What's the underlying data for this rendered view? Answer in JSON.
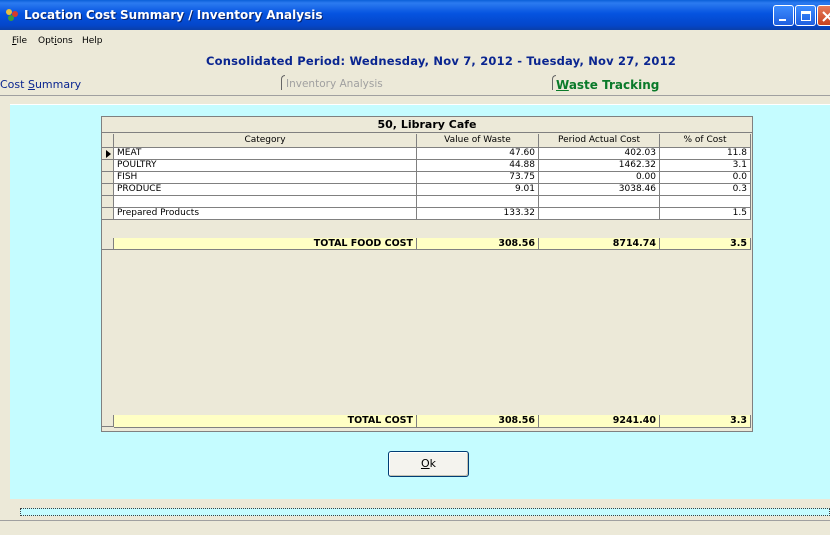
{
  "window": {
    "title": "Location Cost Summary / Inventory Analysis"
  },
  "menu": {
    "file": {
      "mnemonic": "F",
      "rest": "ile"
    },
    "options": {
      "prefix": "Opt",
      "mnemonic": "i",
      "rest": "ons"
    },
    "help": "Help"
  },
  "period": "Consolidated Period: Wednesday, Nov 7, 2012 - Tuesday, Nov 27, 2012",
  "tabs": {
    "cost_summary": {
      "prefix": "Cost ",
      "mnemonic": "S",
      "rest": "ummary"
    },
    "inventory_analysis": "Inventory Analysis",
    "waste_tracking": {
      "mnemonic": "W",
      "rest": "aste Tracking"
    }
  },
  "grid": {
    "title": "50, Library Cafe",
    "columns": [
      "Category",
      "Value of Waste",
      "Period Actual Cost",
      "% of Cost"
    ],
    "rows": [
      {
        "category": "MEAT",
        "waste": "47.60",
        "cost": "402.03",
        "pct": "11.8",
        "current": true
      },
      {
        "category": "POULTRY",
        "waste": "44.88",
        "cost": "1462.32",
        "pct": "3.1"
      },
      {
        "category": "FISH",
        "waste": "73.75",
        "cost": "0.00",
        "pct": "0.0"
      },
      {
        "category": "PRODUCE",
        "waste": "9.01",
        "cost": "3038.46",
        "pct": "0.3"
      },
      {
        "category": "",
        "waste": "",
        "cost": "",
        "pct": ""
      },
      {
        "category": "Prepared Products",
        "waste": "133.32",
        "cost": "",
        "pct": "1.5"
      }
    ],
    "food_total": {
      "label": "TOTAL FOOD COST",
      "waste": "308.56",
      "cost": "8714.74",
      "pct": "3.5"
    },
    "grand_total": {
      "label": "TOTAL COST",
      "waste": "308.56",
      "cost": "9241.40",
      "pct": "3.3"
    }
  },
  "ok_button": {
    "mnemonic": "O",
    "rest": "k"
  },
  "colors": {
    "panel": "#C5FCFF",
    "total_row": "#FFFFC4",
    "period_text": "#0A2590",
    "waste_tab": "#0A7A2A"
  }
}
